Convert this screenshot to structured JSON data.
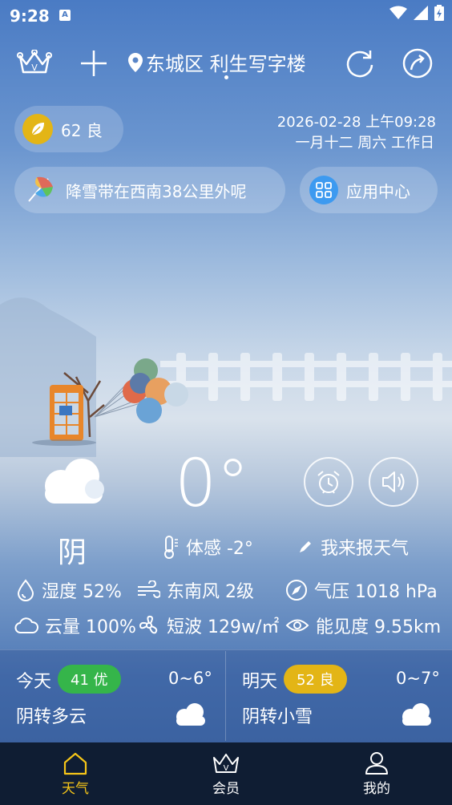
{
  "status_bar": {
    "time": "9:28",
    "notification_badge": "A"
  },
  "header": {
    "location": "东城区 利生写字楼",
    "icons": [
      "crown-icon",
      "plus-icon",
      "location-pin-icon",
      "refresh-icon",
      "share-icon"
    ]
  },
  "aqi": {
    "value": "62",
    "label": "良",
    "color": "#e3b516"
  },
  "date": {
    "line1": "2026-02-28 上午09:28",
    "line2": "一月十二 周六 工作日"
  },
  "alert": {
    "text": "降雪带在西南38公里外呢"
  },
  "app_center": {
    "label": "应用中心"
  },
  "current": {
    "temperature": "0°",
    "condition": "阴",
    "feels_like": "体感 -2°",
    "report": "我来报天气"
  },
  "metrics": {
    "humidity": "湿度 52%",
    "wind": "东南风 2级",
    "pressure": "气压 1018 hPa",
    "cloud": "云量 100%",
    "radiation": "短波 129w/㎡",
    "visibility": "能见度 9.55km"
  },
  "forecast": [
    {
      "day": "今天",
      "aqi": "41 优",
      "aqi_color": "#35b54a",
      "range": "0~6°",
      "condition": "阴转多云"
    },
    {
      "day": "明天",
      "aqi": "52 良",
      "aqi_color": "#e3b516",
      "range": "0~7°",
      "condition": "阴转小雪"
    }
  ],
  "nav": [
    {
      "label": "天气",
      "active": true,
      "active_color": "#f5c518"
    },
    {
      "label": "会员",
      "active": false
    },
    {
      "label": "我的",
      "active": false
    }
  ]
}
